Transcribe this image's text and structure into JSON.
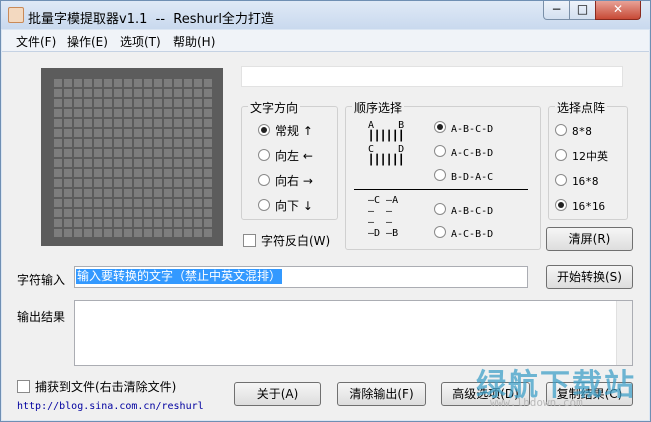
{
  "window": {
    "title": "批量字模提取器v1.1  --  Reshurl全力打造",
    "min": "−",
    "max": "□",
    "close": "✕"
  },
  "menu": [
    "文件(F)",
    "操作(E)",
    "选项(T)",
    "帮助(H)"
  ],
  "direction": {
    "title": "文字方向",
    "options": [
      "常规 ↑",
      "向左 ←",
      "向右 →",
      "向下 ↓"
    ],
    "selected": 0
  },
  "order": {
    "title": "顺序选择",
    "diagram_top": [
      "A    B",
      "┃┃┃┃┃┃",
      "C    D",
      "┃┃┃┃┃┃"
    ],
    "options_top": [
      "A-B-C-D",
      "A-C-B-D",
      "B-D-A-C"
    ],
    "selected": 0,
    "diagram_bottom": [
      "—C —A",
      "—  —",
      "—  —",
      "—D —B"
    ],
    "options_bottom": [
      "A-B-C-D",
      "A-C-B-D"
    ]
  },
  "dotmatrix": {
    "title": "选择点阵",
    "options": [
      "8*8",
      "12中英",
      "16*8",
      "16*16"
    ],
    "selected": 3
  },
  "invert": {
    "label": "字符反白(W)",
    "checked": false
  },
  "clear_screen": "清屏(R)",
  "input": {
    "label": "字符输入",
    "value": "输入要转换的文字（禁止中英文混排）"
  },
  "convert_button": "开始转换(S)",
  "output": {
    "label": "输出结果",
    "value": ""
  },
  "capture_file": {
    "label": "捕获到文件(右击清除文件)",
    "checked": false
  },
  "buttons": {
    "about": "关于(A)",
    "clear_output": "清除输出(F)",
    "advanced": "高级选项(D)",
    "copy": "复制结果(C)"
  },
  "url": "http://blog.sina.com.cn/reshurl",
  "watermark": {
    "text": "绿航下载站",
    "url": "www.lhdown.com"
  }
}
